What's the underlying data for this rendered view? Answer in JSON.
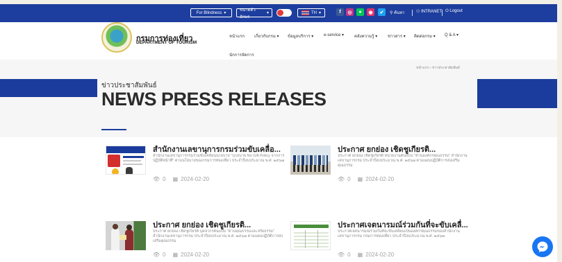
{
  "colors": {
    "topbar": "#1d3e9e",
    "accent": "#1b3c9c",
    "title": "#2b2b2b",
    "meta": "#a3a3a3",
    "chat": "#1876f2"
  },
  "topbar": {
    "blindness": "For Blindness",
    "font_select": "ขนาดตัวอักษร",
    "language": "TH",
    "search": "ค้นหา",
    "intranet": "INTRANET",
    "logout": "Logout"
  },
  "header": {
    "org_name_th": "กรมการท่องเที่ยว",
    "org_name_en": "DEPARTMENT OF TOURISM",
    "nav": [
      "หน้าแรก",
      "เกี่ยวกับกรม",
      "ข้อมูลบริการ",
      "e-service",
      "คลังความรู้",
      "ข่าวสาร",
      "ติดต่อกรม",
      "Q & A"
    ],
    "nav_second_row": "นักการจัดการ"
  },
  "hero": {
    "breadcrumb_home": "หน้าแรก",
    "breadcrumb_current": "ข่าวประชาสัมพันธ์",
    "subtitle": "ข่าวประชาสัมพันธ์",
    "title": "NEWS PRESS RELEASES"
  },
  "news": [
    {
      "title": "สำนักงานเลขานุการกรมร่วมขับเคลื่อ...",
      "description": "สำนักงานเลขานุการกรมร่วมขับเคลื่อนนโยบาย \"นโยบาย No Gift Policy จากการปฏิบัติหน้าที่\" ตามนโยบายของกรมการท่องเที่ยว ประจำปีงบประมาณ พ.ศ. ๒๕๖๗",
      "views": "0",
      "date": "2024-02-20",
      "thumb_icon": "no-gift-policy-poster-icon"
    },
    {
      "title": "ประกาศ ยกย่อง เชิดชูเกียรติ...",
      "description": "ประกาศ ยกย่อง เชิดชูเกียรติ หน่วยงานต้นแบบ \"ด้านองค์กรคุณธรรม\" สำนักงานเลขานุการกรม ประจำปีงบประมาณ พ.ศ. ๒๕๖๗ ตามแผนปฏิบัติการส่งเสริมคุณธรรม",
      "views": "0",
      "date": "2024-02-20",
      "thumb_icon": "group-photo-icon"
    },
    {
      "title": "ประกาศ ยกย่อง เชิดชูเกียรติ...",
      "description": "ประกาศ ยกย่อง เชิดชูเกียรติ บุคลากรต้นแบบ \"ด้านคุณธรรมและจริยธรรม\" สำนักงานเลขานุการกรม ประจำปีงบประมาณ พ.ศ. ๒๕๖๗ ตามแผนปฏิบัติการส่งเสริมคุณธรรม",
      "views": "0",
      "date": "2024-02-20",
      "thumb_icon": "award-handover-photo-icon"
    },
    {
      "title": "ประกาศเจตนารมณ์ร่วมกันที่จะขับเคลื่...",
      "description": "ประกาศเจตนารมณ์ร่วมกันที่จะขับเคลื่อนเป็นองค์กรคุณธรรมของสำนักงานเลขานุการกรม กรมการท่องเที่ยว ประจำปีงบประมาณ พ.ศ. ๒๕๖๗",
      "views": "0",
      "date": "2024-02-20",
      "thumb_icon": "document-table-icon"
    }
  ]
}
